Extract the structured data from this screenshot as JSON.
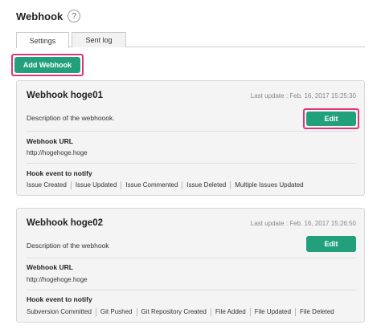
{
  "page": {
    "title": "Webhook",
    "help_icon": "question-mark",
    "add_button_label": "Add Webhook"
  },
  "tabs": [
    {
      "label": "Settings",
      "active": true
    },
    {
      "label": "Sent log",
      "active": false
    }
  ],
  "colors": {
    "accent": "#22a07b",
    "highlight": "#e0337f"
  },
  "webhooks": [
    {
      "name": "Webhook hoge01",
      "last_update": "Last update : Feb. 16, 2017 15:25:30",
      "description": "Description of the webhoook.",
      "edit_label": "Edit",
      "url_label": "Webhook URL",
      "url": "http://hogehoge.hoge",
      "events_label": "Hook event to notify",
      "events": [
        "Issue Created",
        "Issue Updated",
        "Issue Commented",
        "Issue Deleted",
        "Multiple Issues Updated"
      ]
    },
    {
      "name": "Webhook hoge02",
      "last_update": "Last update : Feb. 16, 2017 15:26:50",
      "description": "Description of the webhook",
      "edit_label": "Edit",
      "url_label": "Webhook URL",
      "url": "http://hogehoge.hoge",
      "events_label": "Hook event to notify",
      "events": [
        "Subversion Committed",
        "Git Pushed",
        "Git Repository Created",
        "File Added",
        "File Updated",
        "File Deleted"
      ]
    }
  ]
}
